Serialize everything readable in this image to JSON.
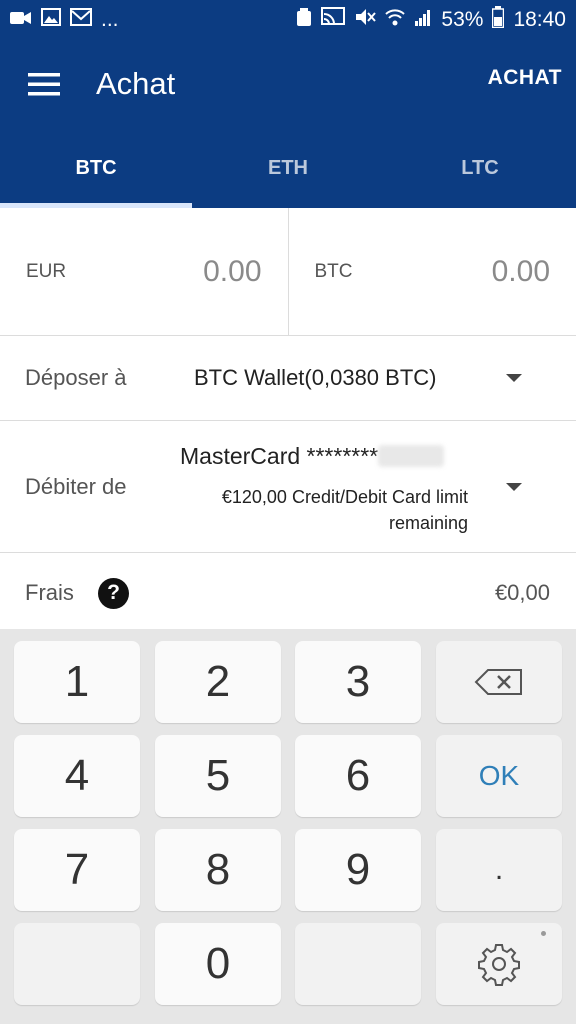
{
  "status_bar": {
    "more": "...",
    "battery": "53%",
    "time": "18:40"
  },
  "app_bar": {
    "title": "Achat",
    "action": "ACHAT"
  },
  "tabs": [
    {
      "label": "BTC",
      "active": true
    },
    {
      "label": "ETH",
      "active": false
    },
    {
      "label": "LTC",
      "active": false
    }
  ],
  "amounts": {
    "left": {
      "currency": "EUR",
      "value": "0.00"
    },
    "right": {
      "currency": "BTC",
      "value": "0.00"
    }
  },
  "deposit": {
    "label": "Déposer à",
    "value": "BTC Wallet(0,0380 BTC)"
  },
  "debit": {
    "label": "Débiter de",
    "card": "MasterCard ********",
    "limit": "€120,00 Credit/Debit Card limit remaining"
  },
  "fees": {
    "label": "Frais",
    "help": "?",
    "value": "€0,00"
  },
  "keyboard": {
    "k1": "1",
    "k2": "2",
    "k3": "3",
    "k4": "4",
    "k5": "5",
    "k6": "6",
    "k7": "7",
    "k8": "8",
    "k9": "9",
    "k0": "0",
    "ok": "OK",
    "dot": "."
  },
  "colors": {
    "brand": "#0c3c82",
    "tab_indicator": "#d9e6fb",
    "ok_key": "#2f7fb8"
  }
}
